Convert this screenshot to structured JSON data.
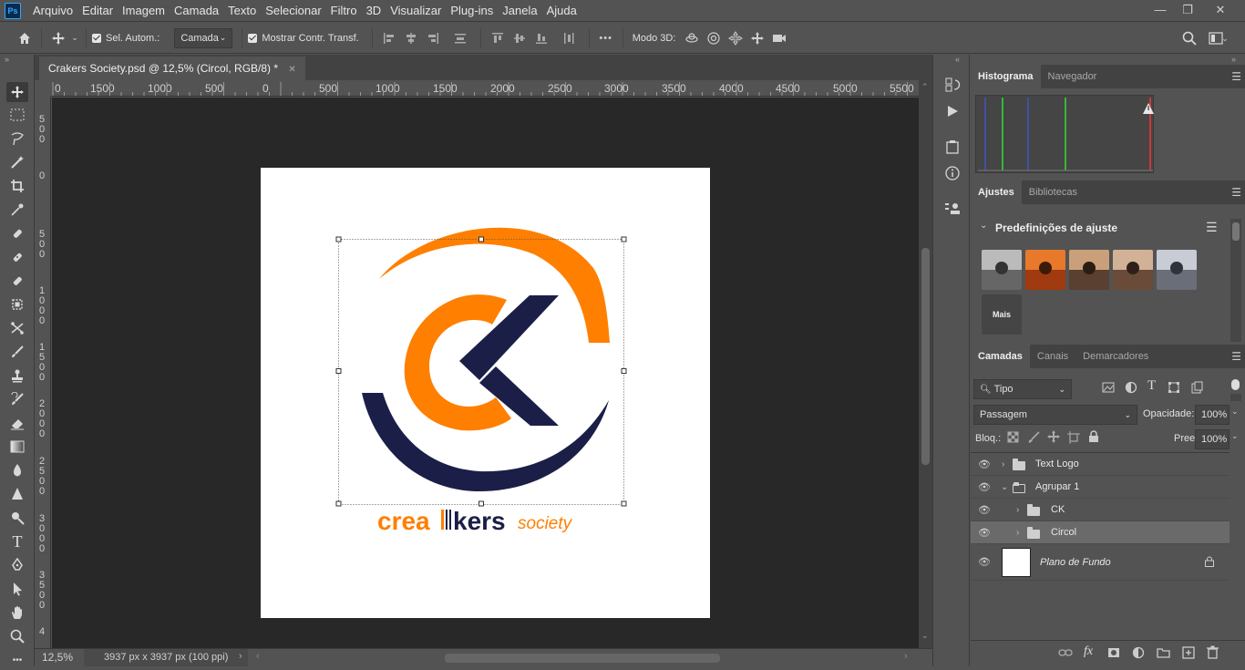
{
  "app": {
    "logo": "Ps"
  },
  "menu": [
    "Arquivo",
    "Editar",
    "Imagem",
    "Camada",
    "Texto",
    "Selecionar",
    "Filtro",
    "3D",
    "Visualizar",
    "Plug-ins",
    "Janela",
    "Ajuda"
  ],
  "window_controls": {
    "minimize": "—",
    "restore": "❐",
    "close": "✕"
  },
  "options": {
    "auto_select_label": "Sel. Autom.:",
    "auto_select_target": "Camada",
    "show_transform_label": "Mostrar Contr. Transf.",
    "more": "•••",
    "mode3d_label": "Modo 3D:"
  },
  "document": {
    "tab_title": "Crakers Society.psd @ 12,5% (Circol, RGB/8) *",
    "close": "✕",
    "zoom": "12,5%",
    "size_info": "3937 px x 3937 px (100 ppi)"
  },
  "ruler_top": [
    "0",
    "1500",
    "1000",
    "500",
    "0",
    "500",
    "1000",
    "1500",
    "2000",
    "2500",
    "3000",
    "3500",
    "4000",
    "4500",
    "5000",
    "5500"
  ],
  "ruler_left": [
    [
      "5",
      "0",
      "0"
    ],
    [
      "0"
    ],
    [
      "5",
      "0",
      "0"
    ],
    [
      "1",
      "0",
      "0",
      "0"
    ],
    [
      "1",
      "5",
      "0",
      "0"
    ],
    [
      "2",
      "0",
      "0",
      "0"
    ],
    [
      "2",
      "5",
      "0",
      "0"
    ],
    [
      "3",
      "0",
      "0",
      "0"
    ],
    [
      "3",
      "5",
      "0",
      "0"
    ],
    [
      "4"
    ]
  ],
  "logo": {
    "text_a": "crea",
    "text_b": "kers",
    "text_c": "society",
    "orange": "#ff7f00",
    "navy": "#1b1f47"
  },
  "panels": {
    "histogram_tabs": [
      "Histograma",
      "Navegador"
    ],
    "adjust_tabs": [
      "Ajustes",
      "Bibliotecas"
    ],
    "presets_title": "Predefinições de ajuste",
    "more_label": "Mais",
    "layers_tabs": [
      "Camadas",
      "Canais",
      "Demarcadores"
    ],
    "filter_kind": "Tipo",
    "blend_mode": "Passagem",
    "opacity_label": "Opacidade:",
    "opacity_value": "100%",
    "lock_label": "Bloq.:",
    "fill_label": "Preen.:",
    "fill_value": "100%",
    "layers": [
      {
        "name": "Text Logo",
        "type": "group",
        "indent": 0,
        "expanded": false
      },
      {
        "name": "Agrupar 1",
        "type": "group",
        "indent": 0,
        "expanded": true
      },
      {
        "name": "CK",
        "type": "group",
        "indent": 1,
        "expanded": false
      },
      {
        "name": "Circol",
        "type": "group",
        "indent": 1,
        "expanded": false,
        "selected": true
      },
      {
        "name": "Plano de Fundo",
        "type": "background",
        "indent": 0
      }
    ]
  }
}
